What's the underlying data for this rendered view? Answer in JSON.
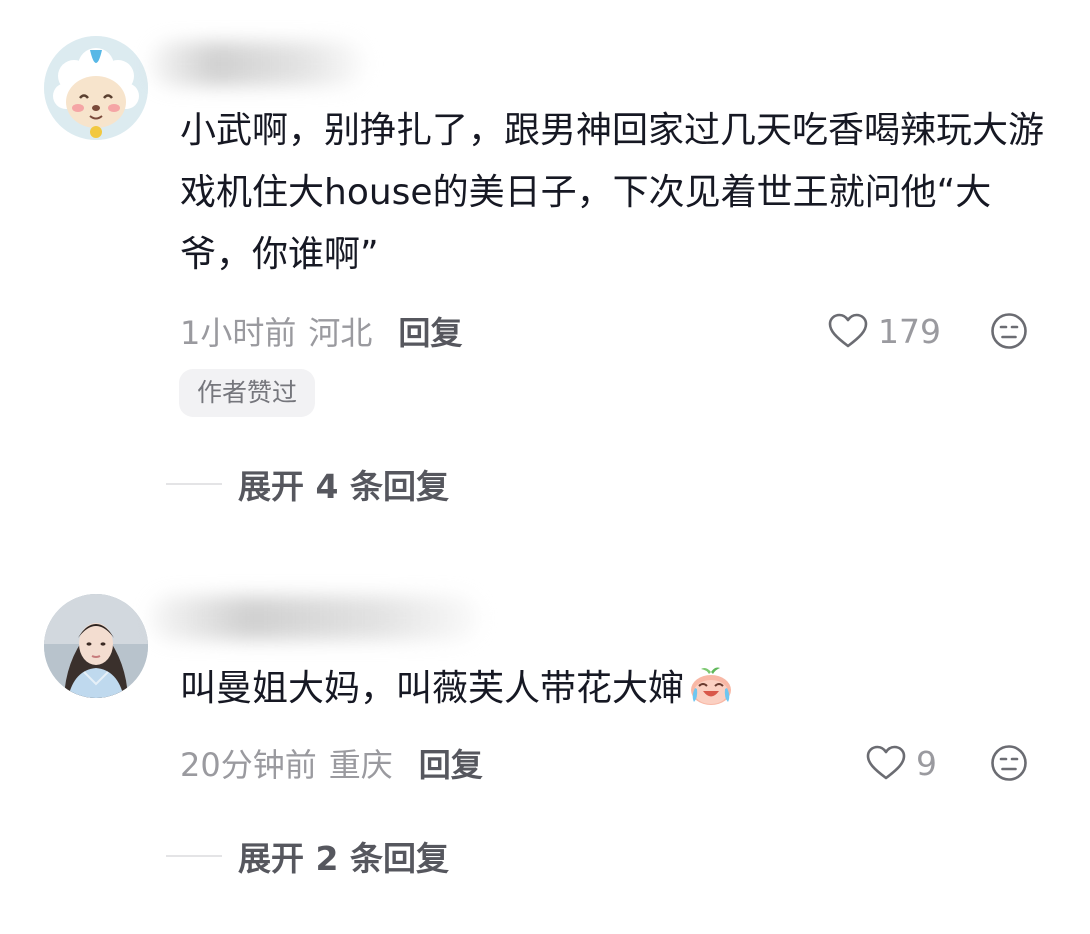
{
  "comments": [
    {
      "text": "小武啊，别挣扎了，跟男神回家过几天吃香喝辣玩大游戏机住大house的美日子，下次见着世王就问他“大爷，你谁啊”",
      "time": "1小时前",
      "location": "河北",
      "reply_label": "回复",
      "likes": "179",
      "badge": "作者赞过",
      "expand_label": "展开 4 条回复",
      "avatar_icon": "cartoon-sheep-avatar"
    },
    {
      "text": "叫曼姐大妈，叫薇芙人带花大婶",
      "emoji_icon": "crying-laughing-peach-emoji",
      "time": "20分钟前",
      "location": "重庆",
      "reply_label": "回复",
      "likes": "9",
      "expand_label": "展开 2 条回复",
      "avatar_icon": "woman-photo-avatar"
    }
  ],
  "colors": {
    "text_primary": "#161823",
    "text_secondary": "#9a9a9f",
    "reply": "#56575e",
    "badge_bg": "#f2f2f4"
  }
}
